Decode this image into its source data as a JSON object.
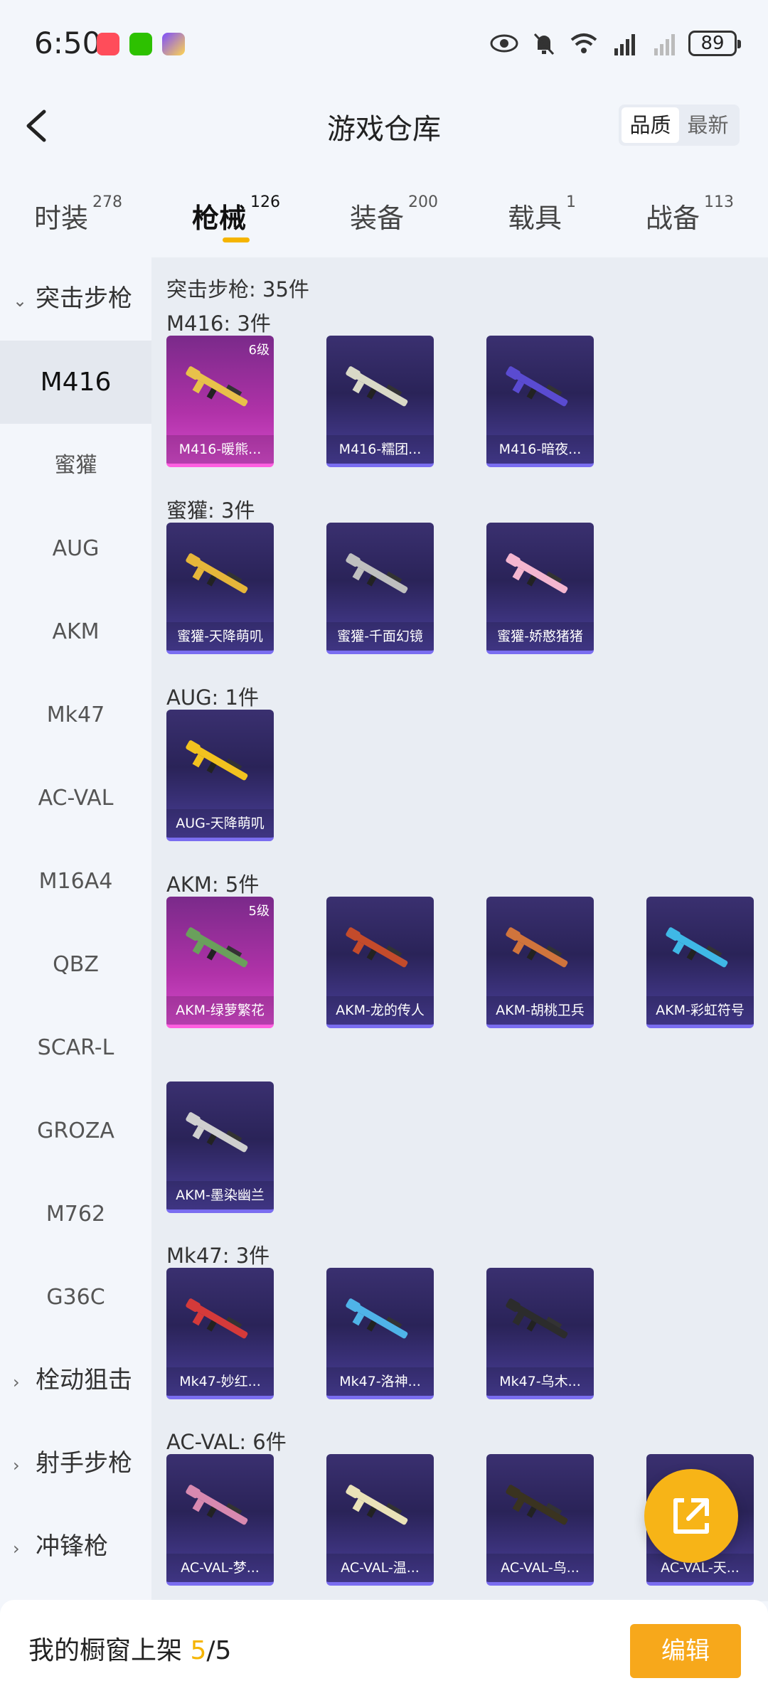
{
  "status": {
    "time": "6:50",
    "battery": "89"
  },
  "header": {
    "title": "游戏仓库",
    "sort_options": [
      "品质",
      "最新"
    ],
    "sort_selected": "品质"
  },
  "tabs": [
    {
      "label": "时装",
      "count": "278"
    },
    {
      "label": "枪械",
      "count": "126"
    },
    {
      "label": "装备",
      "count": "200"
    },
    {
      "label": "载具",
      "count": "1"
    },
    {
      "label": "战备",
      "count": "113"
    }
  ],
  "sidebar": {
    "category": "突击步枪",
    "items": [
      "M416",
      "蜜獾",
      "AUG",
      "AKM",
      "Mk47",
      "AC-VAL",
      "M16A4",
      "QBZ",
      "SCAR-L",
      "GROZA",
      "M762",
      "G36C"
    ],
    "other_categories": [
      "栓动狙击",
      "射手步枪",
      "冲锋枪"
    ]
  },
  "content": {
    "category_heading": "突击步枪: 35件",
    "groups": [
      {
        "heading": "M416: 3件",
        "items": [
          {
            "name": "M416-暖熊...",
            "level": "6级",
            "rarity": "pink"
          },
          {
            "name": "M416-糯团...",
            "level": "",
            "rarity": "purple"
          },
          {
            "name": "M416-暗夜...",
            "level": "",
            "rarity": "purple"
          }
        ]
      },
      {
        "heading": "蜜獾: 3件",
        "items": [
          {
            "name": "蜜獾-天降萌叽",
            "level": "",
            "rarity": "purple"
          },
          {
            "name": "蜜獾-千面幻镜",
            "level": "",
            "rarity": "purple"
          },
          {
            "name": "蜜獾-娇憨猪猪",
            "level": "",
            "rarity": "purple"
          }
        ]
      },
      {
        "heading": "AUG: 1件",
        "items": [
          {
            "name": "AUG-天降萌叽",
            "level": "",
            "rarity": "purple"
          }
        ]
      },
      {
        "heading": "AKM: 5件",
        "items": [
          {
            "name": "AKM-绿萝繁花",
            "level": "5级",
            "rarity": "pink"
          },
          {
            "name": "AKM-龙的传人",
            "level": "",
            "rarity": "purple"
          },
          {
            "name": "AKM-胡桃卫兵",
            "level": "",
            "rarity": "purple"
          },
          {
            "name": "AKM-彩虹符号",
            "level": "",
            "rarity": "purple"
          },
          {
            "name": "AKM-墨染幽兰",
            "level": "",
            "rarity": "purple"
          }
        ]
      },
      {
        "heading": "Mk47: 3件",
        "items": [
          {
            "name": "Mk47-妙红...",
            "level": "",
            "rarity": "purple"
          },
          {
            "name": "Mk47-洛神...",
            "level": "",
            "rarity": "purple"
          },
          {
            "name": "Mk47-乌木...",
            "level": "",
            "rarity": "purple"
          }
        ]
      },
      {
        "heading": "AC-VAL: 6件",
        "items": [
          {
            "name": "AC-VAL-梦...",
            "level": "",
            "rarity": "purple"
          },
          {
            "name": "AC-VAL-温...",
            "level": "",
            "rarity": "purple"
          },
          {
            "name": "AC-VAL-鸟...",
            "level": "",
            "rarity": "purple"
          },
          {
            "name": "AC-VAL-天...",
            "level": "",
            "rarity": "purple"
          }
        ]
      }
    ]
  },
  "bottom": {
    "label": "我的橱窗上架",
    "current": "5",
    "total": "/5",
    "edit": "编辑"
  },
  "colors": {
    "accent": "#f5b400",
    "card_purple": "#2a2358",
    "card_pink": "#b032a8"
  },
  "icons": [
    "back-arrow-icon",
    "eye-icon",
    "mute-bell-icon",
    "wifi-icon",
    "signal-5g-icon",
    "battery-icon",
    "share-external-icon"
  ]
}
